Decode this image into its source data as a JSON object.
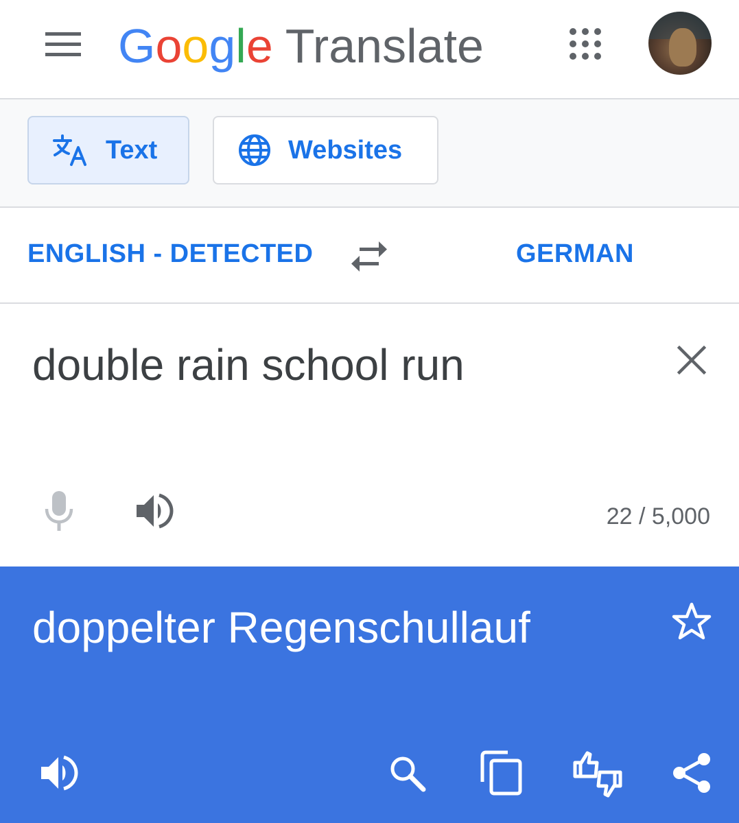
{
  "header": {
    "logo": {
      "G": "G",
      "o1": "o",
      "o2": "o",
      "g": "g",
      "l": "l",
      "e": "e"
    },
    "product": "Translate",
    "icons": [
      "menu-icon",
      "apps-grid-icon",
      "avatar"
    ]
  },
  "modes": {
    "text_label": "Text",
    "websites_label": "Websites"
  },
  "languages": {
    "source": "ENGLISH - DETECTED",
    "target": "GERMAN"
  },
  "source": {
    "text": "double rain school run",
    "char_count": "22 / 5,000"
  },
  "result": {
    "text": "doppelter Regenschullauf"
  },
  "colors": {
    "accent": "#1a73e8",
    "result_bg": "#3b74e0",
    "text_primary": "#3c4043",
    "text_secondary": "#5f6368"
  }
}
